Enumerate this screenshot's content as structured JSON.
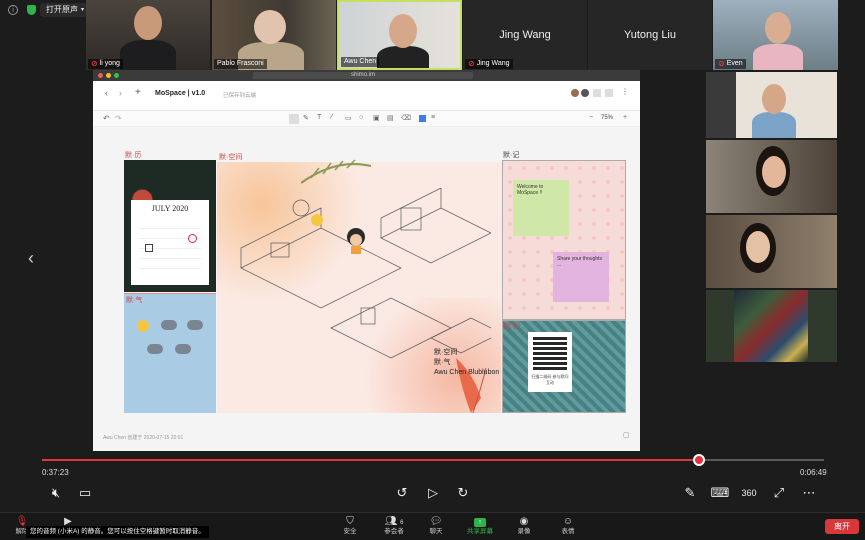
{
  "topbar": {
    "audio_label": "打开原声"
  },
  "tiles": [
    {
      "name": "li yong",
      "muted": true
    },
    {
      "name": "Pablo Frasconi",
      "muted": false
    },
    {
      "name": "Awu Chen",
      "muted": false
    },
    {
      "name": "Jing Wang",
      "muted": true
    },
    {
      "name": "Jing Wang",
      "video_off": true
    },
    {
      "name": "Yutong Liu",
      "video_off": true
    },
    {
      "name": "Even",
      "muted": true
    }
  ],
  "screen": {
    "url": "shimo.im",
    "doc_title": "MoSpace | v1.0",
    "doc_status": "已保存到云端",
    "zoom": "75%",
    "footer_text": "Awu Chen 创建于 2020-07-15 22:01",
    "canvas": {
      "label_calendar": "默·历",
      "label_space": "默·空间",
      "label_notes": "默·记",
      "label_weather": "默·气",
      "label_qr": "默·问",
      "calendar_title": "JULY 2020",
      "note1": "Welcome to MoSpace !!",
      "note2": "Share your thoughts ...",
      "caption_line1": "默·空间",
      "caption_line2": "默·气",
      "caption_line3": "Awu Chen Blublubon",
      "qr_text": "扫描二维码 参与默问互动"
    }
  },
  "player": {
    "current_time": "0:37:23",
    "total_time": "0:06:49",
    "progress": 0.84
  },
  "meetbar": {
    "mute_label": "解除",
    "video_label": "",
    "security_label": "安全",
    "participants_label": "参会者",
    "participants_count": "6",
    "chat_label": "聊天",
    "share_label": "共享屏幕",
    "record_label": "录像",
    "reactions_label": "表情",
    "end_label": "离开",
    "tooltip": "您的音频 (小米A) 的静音。您可以按住空格键暂时取消静音。"
  },
  "colors": {
    "accent_red": "#e0343f",
    "share_green": "#2fb34b",
    "active_speaker": "#c5e060"
  }
}
